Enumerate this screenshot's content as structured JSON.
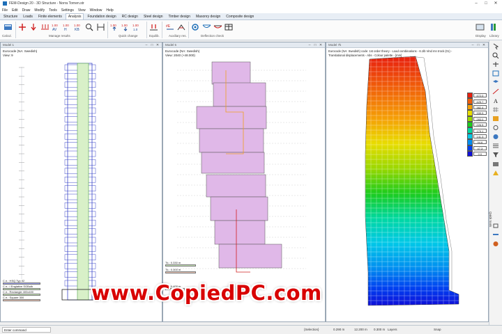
{
  "window": {
    "title": "FEM-Design 20 - 3D Structure - Norra Tornen.str",
    "min": "–",
    "max": "□",
    "close": "✕"
  },
  "menu": [
    "File",
    "Edit",
    "Draw",
    "Modify",
    "Tools",
    "Settings",
    "View",
    "Window",
    "Help"
  ],
  "tabs": [
    "Structure",
    "Loads",
    "Finite elements",
    "Analysis",
    "Foundation design",
    "RC design",
    "Steel design",
    "Timber design",
    "Masonry design",
    "Composite design"
  ],
  "active_tab": "Analysis",
  "ribbon_groups": [
    "Calcul.",
    "Manage results",
    "Quick change",
    "Equilib.",
    "Auxiliary res.",
    "Deflection check",
    "Display",
    "Library"
  ],
  "panels": {
    "left": {
      "title": "Model 1",
      "info": "Eurocode (NA: Swedish)\nView: 9",
      "legend": [
        "C e.: HSQ Typ 02",
        "C e.: I Englative SGBulb",
        "C e.: Rectangle 400x400",
        "C e.: Square 300"
      ]
    },
    "middle": {
      "title": "Model 5",
      "info": "Eurocode (NA: Swedish)\nView: 2040 (+48.000)",
      "legend": [
        "Tk.: 0.330 m",
        "Tk.: 0.300 m",
        "Tk.: 0.400 m"
      ]
    },
    "right": {
      "title": "Model 7k",
      "info": "Eurocode (NA: Swedish) code: 1st order theory - Load combinations - 6.1lb Vind mn trock (01) -\nTranslational displacements - Abs - Colour palette - [mm]"
    }
  },
  "color_scale": {
    "values": [
      "472.0",
      "425.7",
      "382.4",
      "339.9",
      "283.0",
      "226.5",
      "179.1",
      "141.3",
      "94.6",
      "47.3",
      "0.0"
    ],
    "colors": [
      "#e8200f",
      "#f05d0a",
      "#f5a006",
      "#e8dc00",
      "#9ad800",
      "#1ccc1c",
      "#00d8a0",
      "#00c8e8",
      "#008ef0",
      "#0040f0",
      "#1010d8"
    ]
  },
  "right_strip_label": "Quick tools",
  "status": {
    "command_placeholder": "Enter command",
    "selection": "{Selection}",
    "x": "0.290 m",
    "y": "12.200 m",
    "z": "0.300 m",
    "layers": "Layers",
    "snap": "Snap"
  },
  "watermark": "www.CopiedPC.com"
}
